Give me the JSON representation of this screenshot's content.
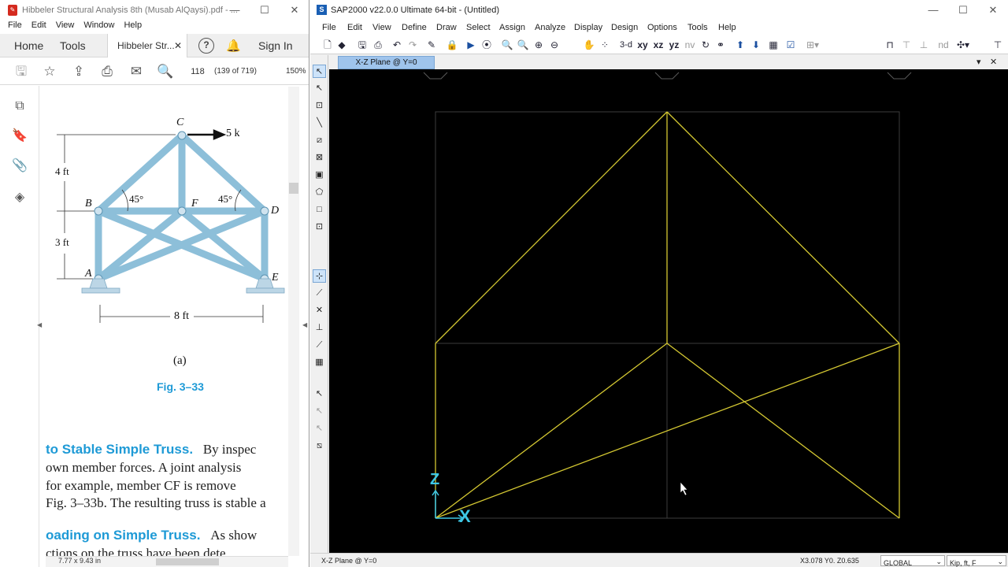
{
  "acrobat": {
    "title": "Hibbeler Structural Analysis  8th  (Musab AlQaysi).pdf - ...",
    "menu": [
      "File",
      "Edit",
      "View",
      "Window",
      "Help"
    ],
    "tabs": {
      "home": "Home",
      "tools": "Tools",
      "doc": "Hibbeler Str...",
      "sign_in": "Sign In"
    },
    "page_number": "118",
    "page_count": "(139 of 719)",
    "zoom": "150%",
    "page_size": "7.77 x 9.43 in",
    "figure": {
      "labels": {
        "C": "C",
        "B": "B",
        "F": "F",
        "D": "D",
        "A": "A",
        "E": "E"
      },
      "load": "5 k",
      "dim_4ft": "4 ft",
      "dim_3ft": "3 ft",
      "dim_8ft": "8 ft",
      "angle_left": "45°",
      "angle_right": "45°",
      "subcaption": "(a)",
      "caption": "Fig. 3–33"
    },
    "text": {
      "heading1": "to Stable Simple Truss.",
      "h1_line1_rest": "By inspec",
      "h1_line2": "own member forces. A joint analysis",
      "h1_line3": "for example, member CF is remove",
      "h1_line4": "Fig. 3–33b. The resulting truss is stable a",
      "heading2": "oading on Simple Truss.",
      "h2_line1_rest": "As show",
      "h2_line2": "ctions on the truss have been dete"
    }
  },
  "sap": {
    "title": "SAP2000 v22.0.0 Ultimate 64-bit - (Untitled)",
    "menu": [
      "File",
      "Edit",
      "View",
      "Define",
      "Draw",
      "Select",
      "Assign",
      "Analyze",
      "Display",
      "Design",
      "Options",
      "Tools",
      "Help"
    ],
    "toolbar_text": {
      "view3d": "3-d",
      "xy": "xy",
      "xz": "xz",
      "yz": "yz",
      "nv": "nv",
      "nd": "nd"
    },
    "pane_title": "X-Z Plane @ Y=0",
    "axis_z": "Z",
    "axis_x": "X",
    "status": {
      "view": "X-Z Plane @ Y=0",
      "coords": "X3.078  Y0.  Z0.635",
      "coord_system": "GLOBAL",
      "units": "Kip, ft, F"
    },
    "colors": {
      "canvas": "#000000",
      "frame": "#d4c832",
      "grid": "#3c3c3c",
      "axis": "#3ec8e6"
    }
  }
}
